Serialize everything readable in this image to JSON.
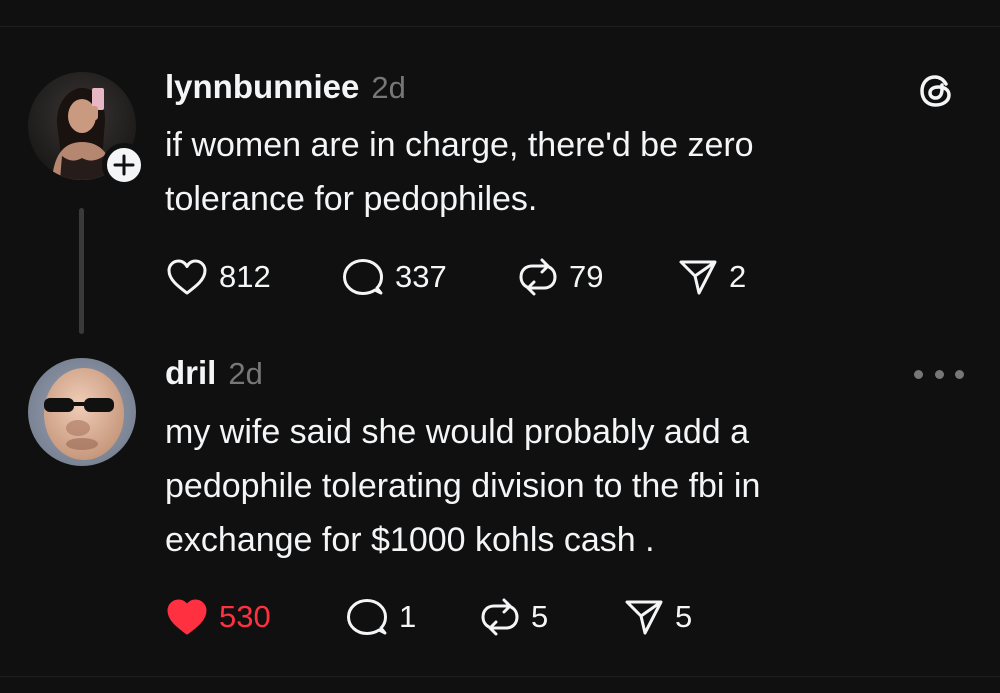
{
  "posts": [
    {
      "username": "lynnbunniee",
      "time": "2d",
      "text": "if women are in charge, there'd be zero\ntolerance for pedophiles.",
      "likes": "812",
      "replies": "337",
      "reposts": "79",
      "shares": "2",
      "liked": false
    },
    {
      "username": "dril",
      "time": "2d",
      "text": "my wife said she would probably add a\npedophile tolerating division to the fbi in\nexchange for $1000 kohls cash .",
      "likes": "530",
      "replies": "1",
      "reposts": "5",
      "shares": "5",
      "liked": true
    }
  ],
  "icons": {
    "follow": "plus-icon",
    "like": "heart-icon",
    "reply": "comment-bubble-icon",
    "repost": "repost-icon",
    "share": "send-icon",
    "brand": "threads-logo-icon",
    "menu": "more-horizontal-icon"
  },
  "colors": {
    "background": "#101010",
    "text": "#f3f5f7",
    "secondary_text": "#777777",
    "like_active": "#ff3040"
  }
}
